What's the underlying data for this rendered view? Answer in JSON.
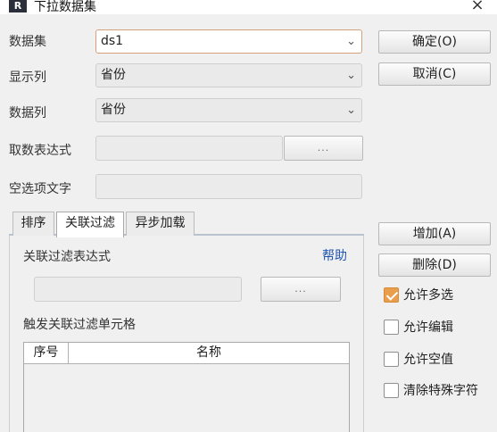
{
  "window": {
    "title": "下拉数据集",
    "app_icon": "R",
    "close_glyph": "×"
  },
  "form": {
    "dataset_label": "数据集",
    "dataset_value": "ds1",
    "display_col_label": "显示列",
    "display_col_value": "省份",
    "data_col_label": "数据列",
    "data_col_value": "省份",
    "expr_label": "取数表达式",
    "expr_value": "",
    "expr_btn": "...",
    "empty_text_label": "空选项文字",
    "empty_text_value": ""
  },
  "buttons": {
    "ok": "确定(O)",
    "cancel": "取消(C)",
    "add": "增加(A)",
    "delete": "删除(D)"
  },
  "tabs": [
    "排序",
    "关联过滤",
    "异步加载"
  ],
  "active_tab": "关联过滤",
  "filter": {
    "expr_label": "关联过滤表达式",
    "help": "帮助",
    "expr_value": "",
    "expr_btn": "...",
    "trigger_label": "触发关联过滤单元格",
    "columns": [
      "序号",
      "名称"
    ],
    "rows": []
  },
  "options": [
    {
      "label": "允许多选",
      "checked": true
    },
    {
      "label": "允许编辑",
      "checked": false
    },
    {
      "label": "允许空值",
      "checked": false
    },
    {
      "label": "清除特殊字符",
      "checked": false
    }
  ],
  "colors": {
    "accent_orange": "#e99e4b",
    "link_blue": "#2155b0"
  }
}
